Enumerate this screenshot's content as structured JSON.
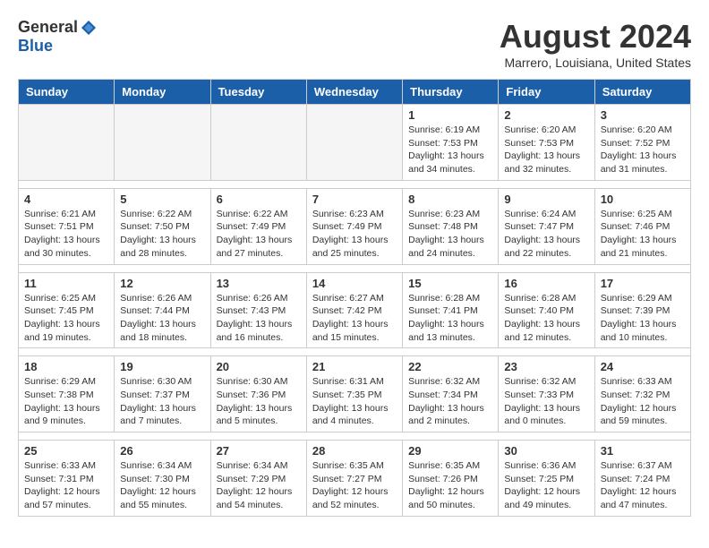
{
  "logo": {
    "general": "General",
    "blue": "Blue"
  },
  "title": "August 2024",
  "location": "Marrero, Louisiana, United States",
  "days_of_week": [
    "Sunday",
    "Monday",
    "Tuesday",
    "Wednesday",
    "Thursday",
    "Friday",
    "Saturday"
  ],
  "weeks": [
    [
      {
        "day": "",
        "info": ""
      },
      {
        "day": "",
        "info": ""
      },
      {
        "day": "",
        "info": ""
      },
      {
        "day": "",
        "info": ""
      },
      {
        "day": "1",
        "info": "Sunrise: 6:19 AM\nSunset: 7:53 PM\nDaylight: 13 hours\nand 34 minutes."
      },
      {
        "day": "2",
        "info": "Sunrise: 6:20 AM\nSunset: 7:53 PM\nDaylight: 13 hours\nand 32 minutes."
      },
      {
        "day": "3",
        "info": "Sunrise: 6:20 AM\nSunset: 7:52 PM\nDaylight: 13 hours\nand 31 minutes."
      }
    ],
    [
      {
        "day": "4",
        "info": "Sunrise: 6:21 AM\nSunset: 7:51 PM\nDaylight: 13 hours\nand 30 minutes."
      },
      {
        "day": "5",
        "info": "Sunrise: 6:22 AM\nSunset: 7:50 PM\nDaylight: 13 hours\nand 28 minutes."
      },
      {
        "day": "6",
        "info": "Sunrise: 6:22 AM\nSunset: 7:49 PM\nDaylight: 13 hours\nand 27 minutes."
      },
      {
        "day": "7",
        "info": "Sunrise: 6:23 AM\nSunset: 7:49 PM\nDaylight: 13 hours\nand 25 minutes."
      },
      {
        "day": "8",
        "info": "Sunrise: 6:23 AM\nSunset: 7:48 PM\nDaylight: 13 hours\nand 24 minutes."
      },
      {
        "day": "9",
        "info": "Sunrise: 6:24 AM\nSunset: 7:47 PM\nDaylight: 13 hours\nand 22 minutes."
      },
      {
        "day": "10",
        "info": "Sunrise: 6:25 AM\nSunset: 7:46 PM\nDaylight: 13 hours\nand 21 minutes."
      }
    ],
    [
      {
        "day": "11",
        "info": "Sunrise: 6:25 AM\nSunset: 7:45 PM\nDaylight: 13 hours\nand 19 minutes."
      },
      {
        "day": "12",
        "info": "Sunrise: 6:26 AM\nSunset: 7:44 PM\nDaylight: 13 hours\nand 18 minutes."
      },
      {
        "day": "13",
        "info": "Sunrise: 6:26 AM\nSunset: 7:43 PM\nDaylight: 13 hours\nand 16 minutes."
      },
      {
        "day": "14",
        "info": "Sunrise: 6:27 AM\nSunset: 7:42 PM\nDaylight: 13 hours\nand 15 minutes."
      },
      {
        "day": "15",
        "info": "Sunrise: 6:28 AM\nSunset: 7:41 PM\nDaylight: 13 hours\nand 13 minutes."
      },
      {
        "day": "16",
        "info": "Sunrise: 6:28 AM\nSunset: 7:40 PM\nDaylight: 13 hours\nand 12 minutes."
      },
      {
        "day": "17",
        "info": "Sunrise: 6:29 AM\nSunset: 7:39 PM\nDaylight: 13 hours\nand 10 minutes."
      }
    ],
    [
      {
        "day": "18",
        "info": "Sunrise: 6:29 AM\nSunset: 7:38 PM\nDaylight: 13 hours\nand 9 minutes."
      },
      {
        "day": "19",
        "info": "Sunrise: 6:30 AM\nSunset: 7:37 PM\nDaylight: 13 hours\nand 7 minutes."
      },
      {
        "day": "20",
        "info": "Sunrise: 6:30 AM\nSunset: 7:36 PM\nDaylight: 13 hours\nand 5 minutes."
      },
      {
        "day": "21",
        "info": "Sunrise: 6:31 AM\nSunset: 7:35 PM\nDaylight: 13 hours\nand 4 minutes."
      },
      {
        "day": "22",
        "info": "Sunrise: 6:32 AM\nSunset: 7:34 PM\nDaylight: 13 hours\nand 2 minutes."
      },
      {
        "day": "23",
        "info": "Sunrise: 6:32 AM\nSunset: 7:33 PM\nDaylight: 13 hours\nand 0 minutes."
      },
      {
        "day": "24",
        "info": "Sunrise: 6:33 AM\nSunset: 7:32 PM\nDaylight: 12 hours\nand 59 minutes."
      }
    ],
    [
      {
        "day": "25",
        "info": "Sunrise: 6:33 AM\nSunset: 7:31 PM\nDaylight: 12 hours\nand 57 minutes."
      },
      {
        "day": "26",
        "info": "Sunrise: 6:34 AM\nSunset: 7:30 PM\nDaylight: 12 hours\nand 55 minutes."
      },
      {
        "day": "27",
        "info": "Sunrise: 6:34 AM\nSunset: 7:29 PM\nDaylight: 12 hours\nand 54 minutes."
      },
      {
        "day": "28",
        "info": "Sunrise: 6:35 AM\nSunset: 7:27 PM\nDaylight: 12 hours\nand 52 minutes."
      },
      {
        "day": "29",
        "info": "Sunrise: 6:35 AM\nSunset: 7:26 PM\nDaylight: 12 hours\nand 50 minutes."
      },
      {
        "day": "30",
        "info": "Sunrise: 6:36 AM\nSunset: 7:25 PM\nDaylight: 12 hours\nand 49 minutes."
      },
      {
        "day": "31",
        "info": "Sunrise: 6:37 AM\nSunset: 7:24 PM\nDaylight: 12 hours\nand 47 minutes."
      }
    ]
  ]
}
